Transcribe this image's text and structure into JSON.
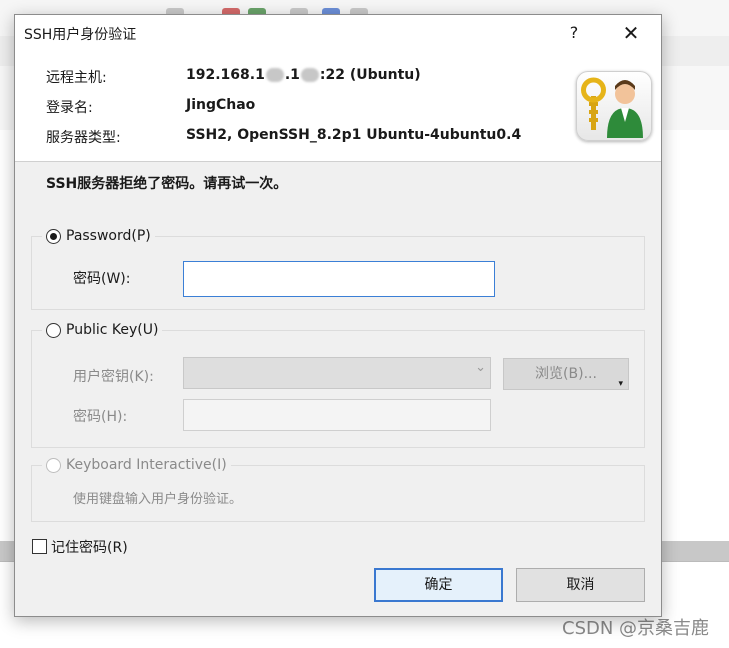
{
  "dialog": {
    "title": "SSH用户身份验证",
    "help_glyph": "?",
    "close_glyph": "✕"
  },
  "info": {
    "host_label": "远程主机:",
    "host_prefix": "192.168.1",
    "host_mid": ".1",
    "host_suffix": ":22 (Ubuntu)",
    "login_label": "登录名:",
    "login_value": "JingChao",
    "server_type_label": "服务器类型:",
    "server_type_value": "SSH2, OpenSSH_8.2p1 Ubuntu-4ubuntu0.4"
  },
  "message": "SSH服务器拒绝了密码。请再试一次。",
  "password_method": {
    "label": "Password(P)",
    "selected": true,
    "field_label": "密码(W):",
    "field_value": ""
  },
  "publickey_method": {
    "label": "Public Key(U)",
    "selected": false,
    "user_key_label": "用户密钥(K):",
    "user_key_value": "",
    "browse_label": "浏览(B)...",
    "passphrase_label": "密码(H):",
    "passphrase_value": ""
  },
  "keyboard_method": {
    "label": "Keyboard Interactive(I)",
    "selected": false,
    "description": "使用键盘输入用户身份验证。"
  },
  "remember_password": {
    "label": "记住密码(R)",
    "checked": false
  },
  "buttons": {
    "ok": "确定",
    "cancel": "取消"
  },
  "watermark": "CSDN @京桑吉鹿",
  "colors": {
    "focus_border": "#3b7fd6",
    "default_button_border": "#3a78d0"
  }
}
